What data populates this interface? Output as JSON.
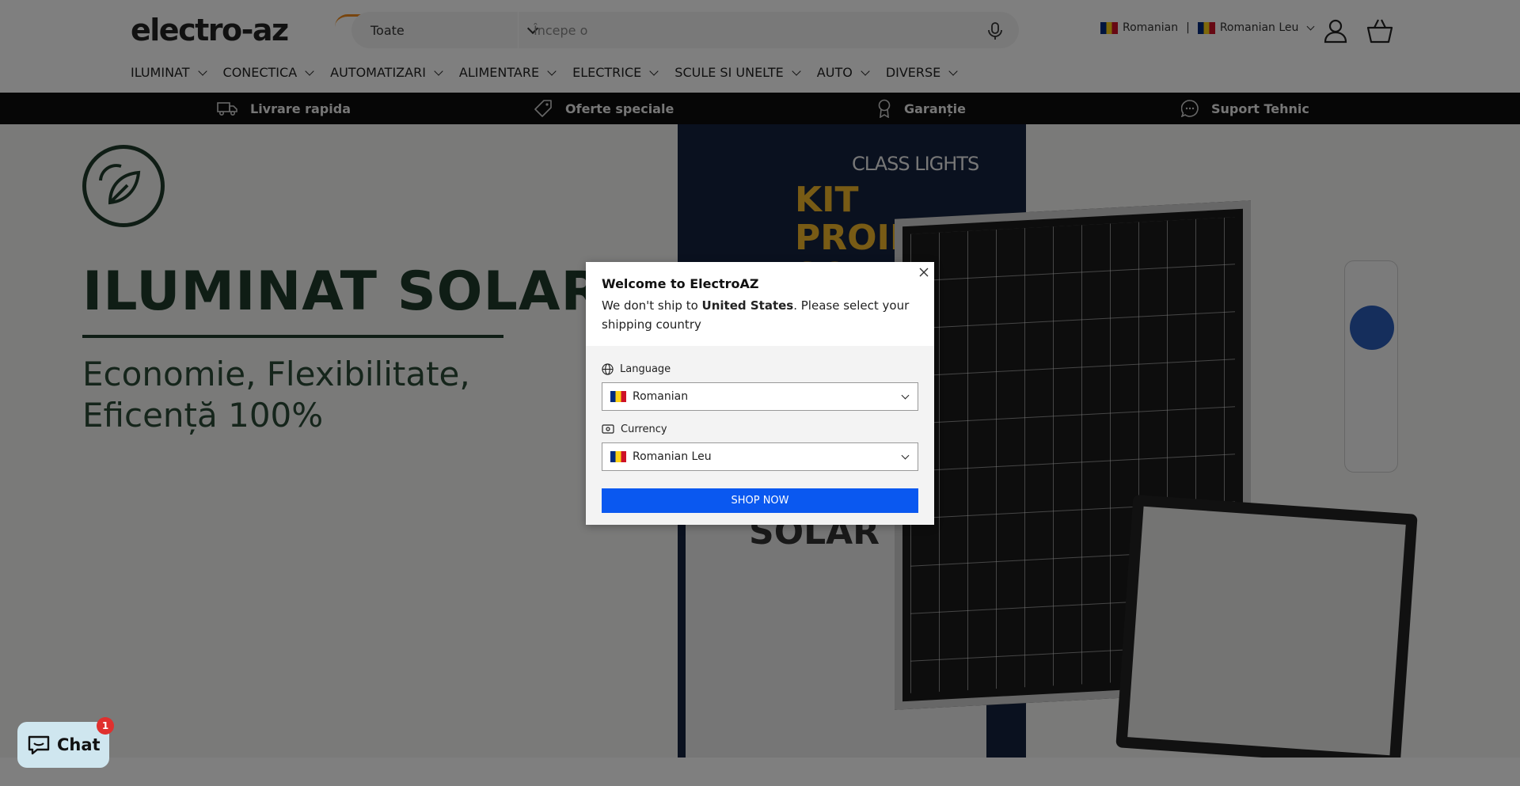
{
  "header": {
    "logo_text": "electro-az",
    "search": {
      "category": "Toate",
      "placeholder": "Începe o"
    },
    "locale": {
      "language": "Romanian",
      "separator": "|",
      "currency": "Romanian Leu"
    }
  },
  "nav": {
    "items": [
      {
        "label": "ILUMINAT"
      },
      {
        "label": "CONECTICA"
      },
      {
        "label": "AUTOMATIZARI"
      },
      {
        "label": "ALIMENTARE"
      },
      {
        "label": "ELECTRICE"
      },
      {
        "label": "SCULE SI UNELTE"
      },
      {
        "label": "AUTO"
      },
      {
        "label": "DIVERSE"
      }
    ]
  },
  "benefits": [
    {
      "label": "Livrare rapida",
      "icon": "truck-icon"
    },
    {
      "label": "Oferte speciale",
      "icon": "tag-icon"
    },
    {
      "label": "Garanție",
      "icon": "award-icon"
    },
    {
      "label": "Suport Tehnic",
      "icon": "chat-bubble-icon"
    }
  ],
  "hero": {
    "title": "ILUMINAT SOLAR",
    "subtitle": "Economie, Flexibilitate, Eficență 100%",
    "product_brand": "CLASS LIGHTS",
    "product_title": "KIT PROIECTOR SOLAR",
    "product_box_text": "SOLAR"
  },
  "modal": {
    "title": "Welcome to ElectroAZ",
    "message_pre": "We don't ship to ",
    "message_country": "United States",
    "message_post": ". Please select your shipping country",
    "language_label": "Language",
    "language_value": "Romanian",
    "currency_label": "Currency",
    "currency_value": "Romanian Leu",
    "shop_button": "SHOP NOW"
  },
  "chat": {
    "label": "Chat",
    "badge": "1"
  },
  "colors": {
    "primary_button": "#0a58f0",
    "strip_bg": "#0c0c0c",
    "hero_text": "#1f3b2a",
    "chat_badge": "#e0302e",
    "logo_accent": "#f08a1c"
  }
}
